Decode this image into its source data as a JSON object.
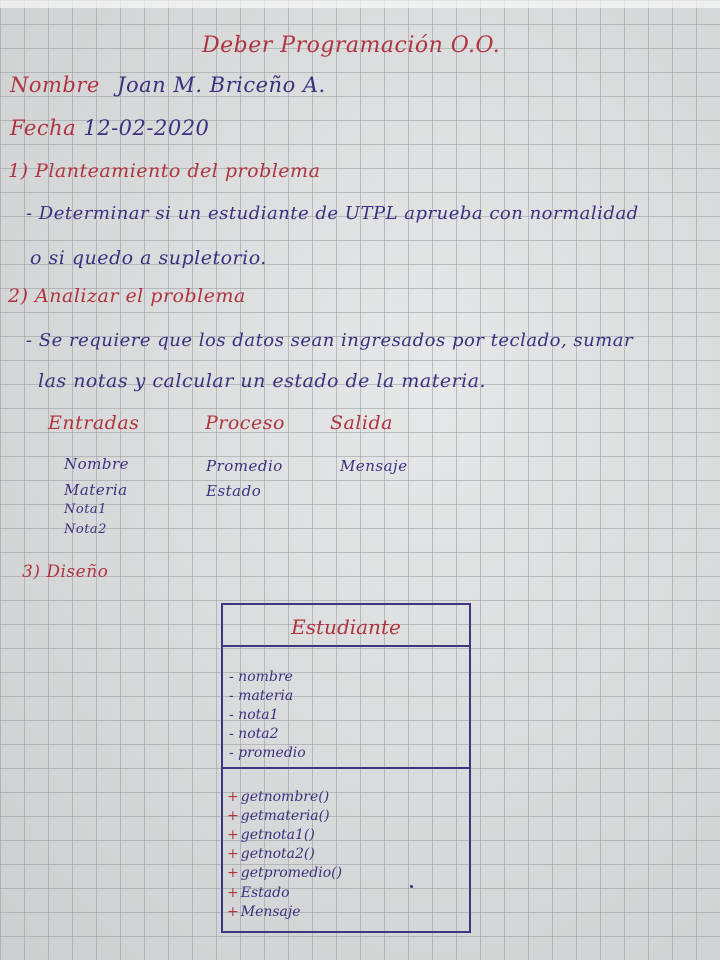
{
  "title": "Deber Programación O.O.",
  "nombre": {
    "label": "Nombre",
    "value": "Joan M. Briceño A."
  },
  "fecha": {
    "label": "Fecha",
    "value": "12-02-2020"
  },
  "sections": {
    "s1_heading": "1) Planteamiento del problema",
    "s1_line1": "- Determinar si un estudiante de UTPL aprueba con normalidad",
    "s1_line2": "o si quedo a supletorio.",
    "s2_heading": "2) Analizar el problema",
    "s2_line1": "- Se requiere que los datos sean ingresados por teclado, sumar",
    "s2_line2": "las notas y calcular un estado de la materia.",
    "s3_heading": "3) Diseño"
  },
  "table": {
    "headers": [
      "Entradas",
      "Proceso",
      "Salida"
    ],
    "entradas": [
      "Nombre",
      "Materia",
      "Nota1",
      "Nota2"
    ],
    "proceso": [
      "Promedio",
      "Estado"
    ],
    "salida": [
      "Mensaje"
    ]
  },
  "uml": {
    "class_name": "Estudiante",
    "attributes": [
      "- nombre",
      "- materia",
      "- nota1",
      "- nota2",
      "- promedio"
    ],
    "methods": [
      "getnombre()",
      "getmateria()",
      "getnota1()",
      "getnota2()",
      "getpromedio()",
      "Estado",
      "Mensaje"
    ],
    "method_prefix": "+"
  },
  "colors": {
    "red_ink": "#b0343f",
    "blue_ink": "#37327f",
    "paper": "#d9dbdc"
  }
}
